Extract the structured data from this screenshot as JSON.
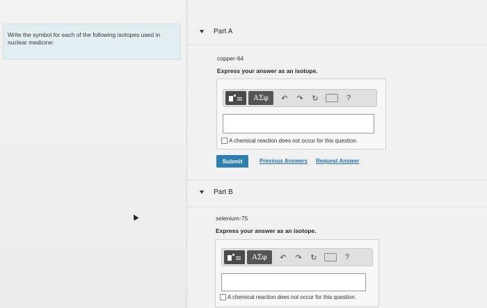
{
  "left": {
    "prompt": "Write the symbol for each of the following isotopes used in nuclear medicine:"
  },
  "toolbar": {
    "greek_label": "ΑΣφ",
    "help_label": "?"
  },
  "partA": {
    "title": "Part A",
    "isotope": "copper-64",
    "instruction": "Express your answer as an isotope.",
    "no_reaction": "A chemical reaction does not occur for this question.",
    "submit": "Submit",
    "previous_answers": "Previous Answers",
    "request_answer": "Request Answer"
  },
  "partB": {
    "title": "Part B",
    "isotope": "selenium-75",
    "instruction": "Express your answer as an isotope.",
    "no_reaction": "A chemical reaction does not occur for this question."
  }
}
